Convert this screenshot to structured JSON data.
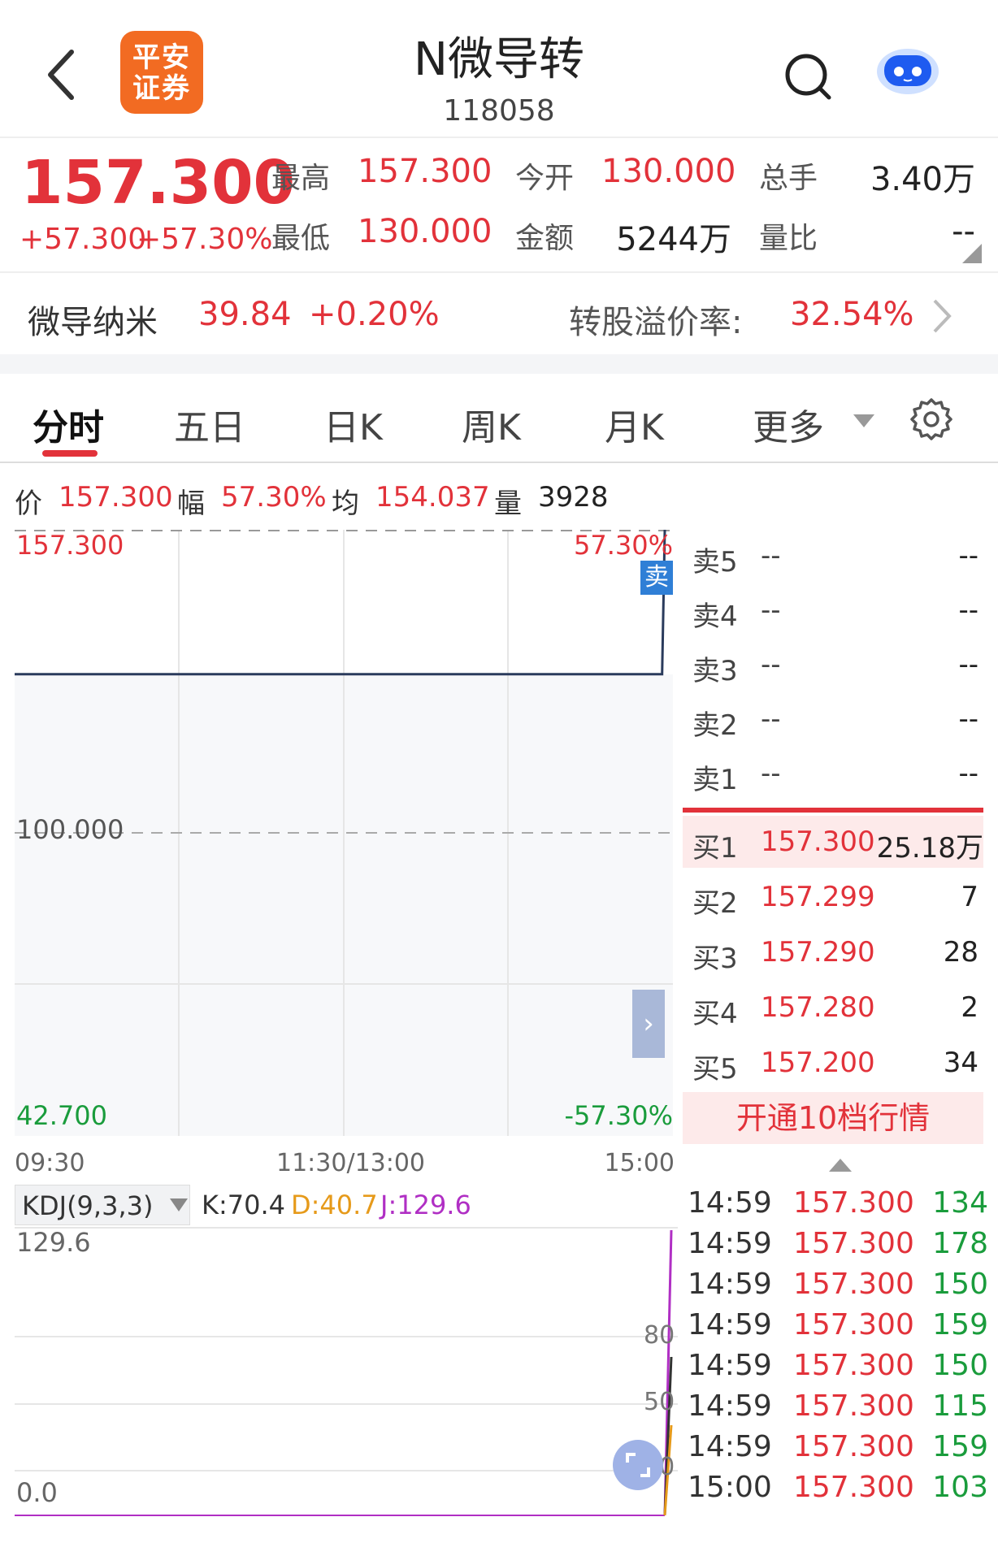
{
  "header": {
    "back_icon": "chevron-left-icon",
    "logo_text_top": "平安",
    "logo_text_bottom": "证券",
    "title": "N微导转",
    "code": "118058",
    "search_icon": "search-icon",
    "assistant_icon": "robot-icon"
  },
  "quote": {
    "price": "157.300",
    "change": "+57.300",
    "change_pct": "+57.30%",
    "high_label": "最高",
    "high": "157.300",
    "open_label": "今开",
    "open": "130.000",
    "total_hands_label": "总手",
    "total_hands": "3.40万",
    "low_label": "最低",
    "low": "130.000",
    "amount_label": "金额",
    "amount": "5244万",
    "vol_ratio_label": "量比",
    "vol_ratio": "--"
  },
  "underlying": {
    "name": "微导纳米",
    "price": "39.84",
    "change_pct": "+0.20%",
    "premium_label": "转股溢价率:",
    "premium": "32.54%"
  },
  "tabs": [
    {
      "label": "分时"
    },
    {
      "label": "五日"
    },
    {
      "label": "日K"
    },
    {
      "label": "周K"
    },
    {
      "label": "月K"
    },
    {
      "label": "更多"
    }
  ],
  "info_bar": {
    "price_label": "价",
    "price": "157.300",
    "range_label": "幅",
    "range": "57.30%",
    "avg_label": "均",
    "avg": "154.037",
    "vol_label": "量",
    "vol": "3928"
  },
  "chart": {
    "y_top": "157.300",
    "y_mid": "100.000",
    "y_bottom": "42.700",
    "pct_top": "57.30%",
    "pct_bottom": "-57.30%",
    "sell_marker": "卖",
    "time_start": "09:30",
    "time_mid": "11:30/13:00",
    "time_end": "15:00"
  },
  "chart_data": {
    "type": "line",
    "x": [
      "09:30",
      "14:59",
      "15:00"
    ],
    "y": [
      130.0,
      130.0,
      157.3
    ],
    "ylim": [
      42.7,
      157.3
    ],
    "title": "",
    "xlabel": "",
    "ylabel": ""
  },
  "orderbook": {
    "sell": [
      {
        "label": "卖5",
        "price": "--",
        "vol": "--"
      },
      {
        "label": "卖4",
        "price": "--",
        "vol": "--"
      },
      {
        "label": "卖3",
        "price": "--",
        "vol": "--"
      },
      {
        "label": "卖2",
        "price": "--",
        "vol": "--"
      },
      {
        "label": "卖1",
        "price": "--",
        "vol": "--"
      }
    ],
    "buy": [
      {
        "label": "买1",
        "price": "157.300",
        "vol": "25.18万"
      },
      {
        "label": "买2",
        "price": "157.299",
        "vol": "7"
      },
      {
        "label": "买3",
        "price": "157.290",
        "vol": "28"
      },
      {
        "label": "买4",
        "price": "157.280",
        "vol": "2"
      },
      {
        "label": "买5",
        "price": "157.200",
        "vol": "34"
      }
    ],
    "upgrade_label": "开通10档行情"
  },
  "kdj": {
    "selector": "KDJ(9,3,3)",
    "k": "K:70.4",
    "d": "D:40.7",
    "j": "J:129.6",
    "y_top": "129.6",
    "y_bottom": "0.0",
    "level_80": "80",
    "level_50": "50",
    "level_20": "20",
    "colors": {
      "k": "#333333",
      "d": "#e69a1a",
      "j": "#b02fc4"
    }
  },
  "ticks": [
    {
      "time": "14:59",
      "price": "157.300",
      "vol": "134"
    },
    {
      "time": "14:59",
      "price": "157.300",
      "vol": "178"
    },
    {
      "time": "14:59",
      "price": "157.300",
      "vol": "150"
    },
    {
      "time": "14:59",
      "price": "157.300",
      "vol": "159"
    },
    {
      "time": "14:59",
      "price": "157.300",
      "vol": "150"
    },
    {
      "time": "14:59",
      "price": "157.300",
      "vol": "115"
    },
    {
      "time": "14:59",
      "price": "157.300",
      "vol": "159"
    },
    {
      "time": "15:00",
      "price": "157.300",
      "vol": "103"
    }
  ]
}
